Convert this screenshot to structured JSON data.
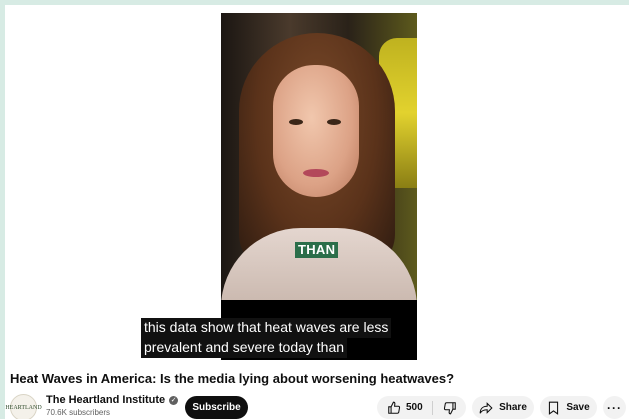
{
  "video": {
    "overlay_word": "THAN",
    "subtitle_line1": "this data show that heat waves are less",
    "subtitle_line2": "prevalent and severe today than"
  },
  "title": "Heat Waves in America: Is the media lying about worsening heatwaves?",
  "channel": {
    "avatar_text": "HEARTLAND",
    "name": "The Heartland Institute",
    "subscribers": "70.6K subscribers",
    "subscribe_label": "Subscribe"
  },
  "actions": {
    "like_count": "500",
    "share_label": "Share",
    "save_label": "Save",
    "more_label": "···"
  },
  "icons": [
    "like-icon",
    "dislike-icon",
    "share-icon",
    "save-icon",
    "more-icon",
    "verified-icon"
  ]
}
